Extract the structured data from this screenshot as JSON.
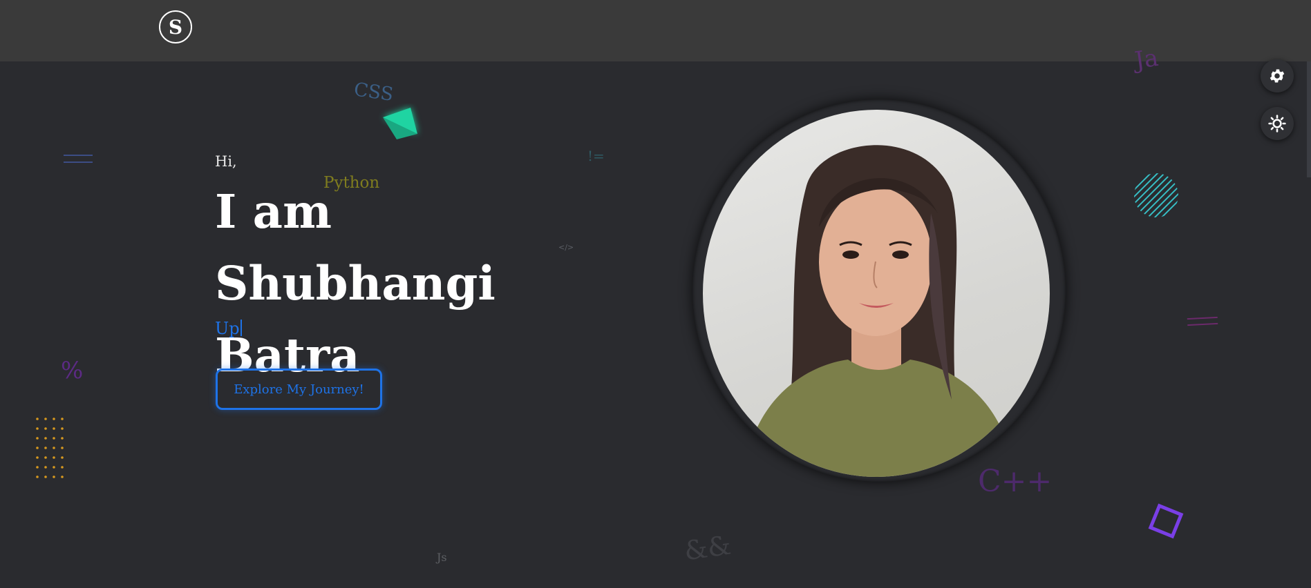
{
  "header": {
    "logo_letter": "S"
  },
  "hero": {
    "greeting": "Hi,",
    "name_line1": "I am Shubhangi",
    "name_line2": "Batra",
    "typed_text": "Up",
    "cta_label": "Explore My Journey!"
  },
  "decorations": {
    "css": "CSS",
    "python": "Python",
    "not_equal": "!=",
    "code_tag": "</>",
    "percent": "%",
    "cpp": "C++",
    "ampersand": "&&",
    "js": "Js",
    "ja": "Ja",
    "equals_left": "==",
    "equals_right": "=="
  },
  "side_controls": {
    "settings_icon": "gear-icon",
    "theme_icon": "sun-icon"
  },
  "colors": {
    "background": "#2a2b2f",
    "topbar": "#3a3a3a",
    "accent": "#1e73e8",
    "green": "#1fd4a2",
    "purple": "#7a3fd6",
    "orange": "#d6981f"
  }
}
